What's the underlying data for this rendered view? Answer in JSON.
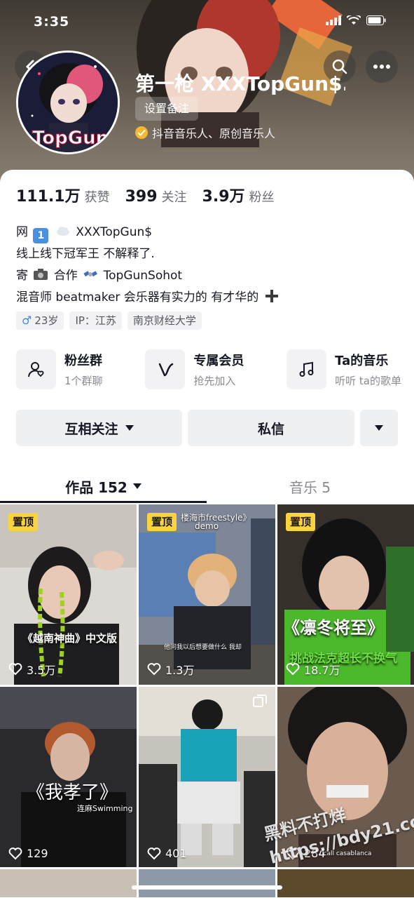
{
  "status_bar": {
    "time": "3:35"
  },
  "profile": {
    "nickname": "第一枪 XXXTopGun$.",
    "remark_button": "设置备注",
    "verified_text": "抖音音乐人、原创音乐人"
  },
  "stats": [
    {
      "value": "111.1万",
      "label": "获赞"
    },
    {
      "value": "399",
      "label": "关注"
    },
    {
      "value": "3.9万",
      "label": "粉丝"
    }
  ],
  "bio": {
    "line1_prefix": "网",
    "line1_text": "XXXTopGun$",
    "line2": "线上线下冠军王 不解释了.",
    "line3_a": "寄",
    "line3_b": "合作",
    "line3_c": "TopGunSohot",
    "line4": "混音师 beatmaker  会乐器有实力的 有才华的"
  },
  "tags": {
    "age": "23岁",
    "ip": "IP：江苏",
    "school": "南京财经大学"
  },
  "features": [
    {
      "title": "粉丝群",
      "subtitle": "1个群聊",
      "icon": "fan-group-icon"
    },
    {
      "title": "专属会员",
      "subtitle": "抢先加入",
      "icon": "membership-v-icon"
    },
    {
      "title": "Ta的音乐",
      "subtitle": "听听 ta的歌单",
      "icon": "music-note-icon"
    }
  ],
  "actions": {
    "follow": "互相关注",
    "message": "私信"
  },
  "tabs": {
    "works": "作品 152",
    "music": "音乐 5"
  },
  "videos": [
    {
      "pinned": "置顶",
      "likes": "3.5万",
      "caption": "《越南神曲》中文版"
    },
    {
      "pinned": "置顶",
      "likes": "1.3万",
      "caption_top": "楼海市freestyle》",
      "caption_sub": "demo",
      "subtitle": "他问我以后想要做什么 我却"
    },
    {
      "pinned": "置顶",
      "likes": "18.7万",
      "caption": "《凛冬将至》",
      "caption_sub": "挑战法克超长不换气"
    },
    {
      "likes": "129",
      "caption": "《我孝了》",
      "caption_sub": "连麻Swimming"
    },
    {
      "likes": "401"
    },
    {
      "likes": "284",
      "caption_sub": "I call casablanca"
    }
  ],
  "watermark": {
    "line1": "黑料不打烊",
    "line2": "https://bdy21.co"
  },
  "colors": {
    "pin_yellow": "#fbd33c",
    "verified_gold": "#f5b82e",
    "text_primary": "#161823",
    "text_secondary": "#8a8b91"
  }
}
